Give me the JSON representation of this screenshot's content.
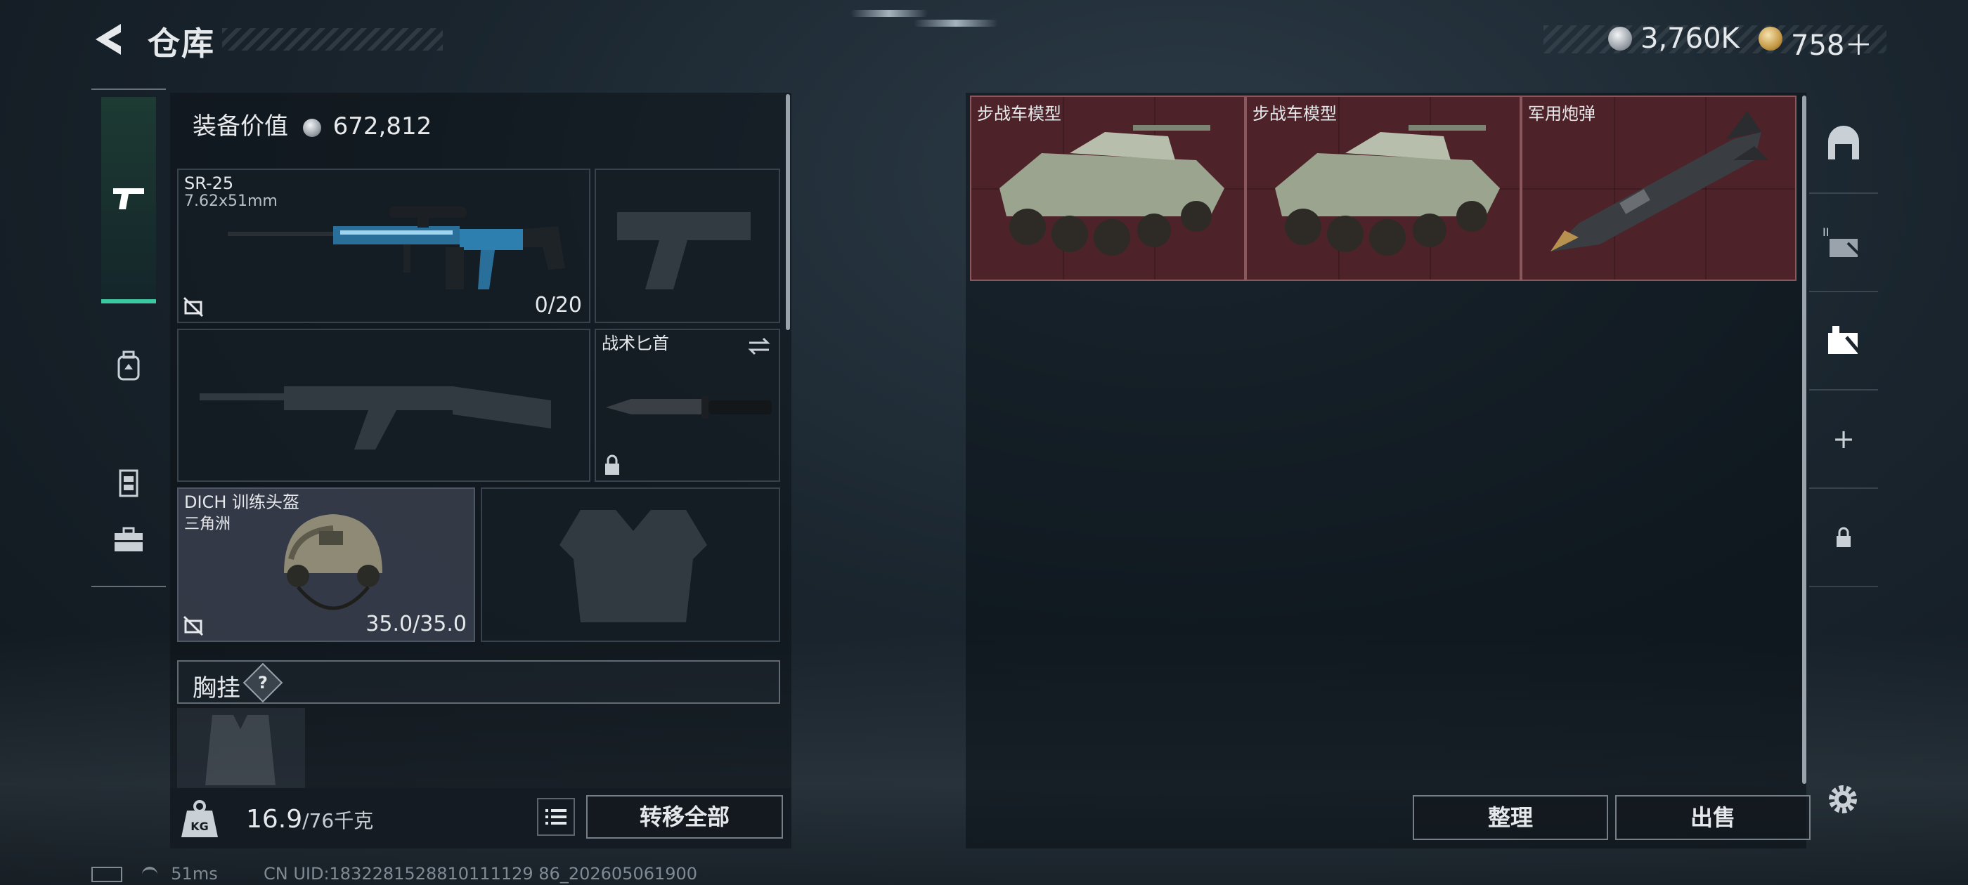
{
  "header": {
    "title": "仓库"
  },
  "currency": {
    "silver": "3,760K",
    "gold": "758＋"
  },
  "left_panel": {
    "equip_value_label": "装备价值",
    "equip_value": "672,812",
    "slots": {
      "primary": {
        "name": "SR-25",
        "caliber": "7.62x51mm",
        "ammo": "0/20"
      },
      "melee": {
        "name": "战术匕首"
      },
      "helmet": {
        "name": "DICH 训练头盔",
        "tag": "三角洲",
        "durability": "35.0/35.0"
      }
    },
    "chest_rig_label": "胸挂",
    "chest_rig_help": "?",
    "weight_current": "16.9",
    "weight_max": "/76千克",
    "transfer_all_label": "转移全部"
  },
  "stash": {
    "items": [
      {
        "name": "步战车模型"
      },
      {
        "name": "步战车模型"
      },
      {
        "name": "军用炮弹"
      }
    ],
    "sort_label": "整理",
    "sell_label": "出售"
  },
  "right_nav": {
    "add": "+"
  },
  "footer": {
    "ping": "51ms",
    "uid": "CN UID:1832281528810111129 86_202605061900"
  },
  "colors": {
    "accent": "#3cc9a1",
    "item_bg": "#4d2329"
  }
}
